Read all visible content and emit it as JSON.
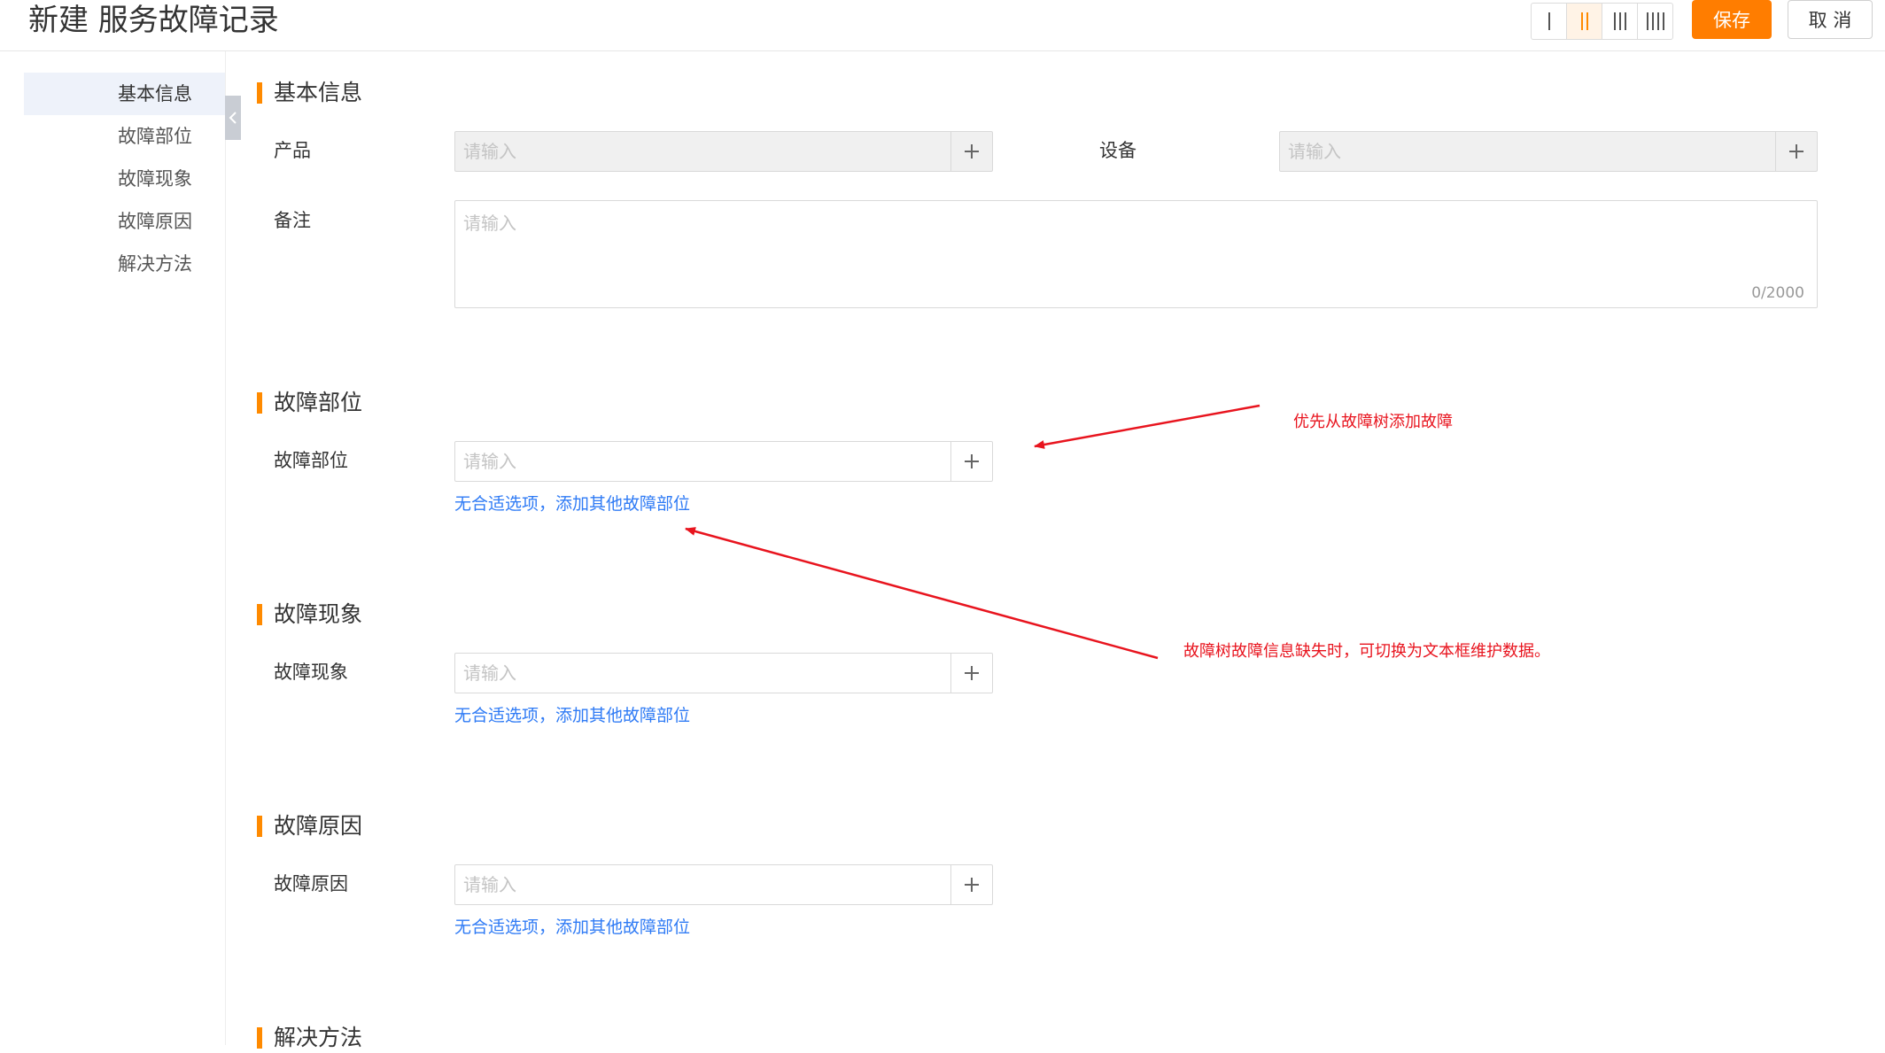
{
  "header": {
    "title": "新建 服务故障记录",
    "save_label": "保存",
    "cancel_label": "取 消",
    "layout_options": [
      "1",
      "2",
      "3",
      "4"
    ],
    "layout_selected": 2
  },
  "sidebar": {
    "items": [
      {
        "label": "基本信息",
        "active": true
      },
      {
        "label": "故障部位",
        "active": false
      },
      {
        "label": "故障现象",
        "active": false
      },
      {
        "label": "故障原因",
        "active": false
      },
      {
        "label": "解决方法",
        "active": false
      }
    ]
  },
  "sections": {
    "basic": {
      "title": "基本信息",
      "product_label": "产品",
      "product_placeholder": "请输入",
      "device_label": "设备",
      "device_placeholder": "请输入",
      "remark_label": "备注",
      "remark_placeholder": "请输入",
      "remark_counter": "0/2000"
    },
    "part": {
      "title": "故障部位",
      "field_label": "故障部位",
      "placeholder": "请输入",
      "link": "无合适选项，添加其他故障部位"
    },
    "phenomenon": {
      "title": "故障现象",
      "field_label": "故障现象",
      "placeholder": "请输入",
      "link": "无合适选项，添加其他故障部位"
    },
    "cause": {
      "title": "故障原因",
      "field_label": "故障原因",
      "placeholder": "请输入",
      "link": "无合适选项，添加其他故障部位"
    },
    "solution": {
      "title": "解决方法"
    }
  },
  "annotations": {
    "note1": "优先从故障树添加故障",
    "note2": "故障树故障信息缺失时，可切换为文本框维护数据。",
    "color": "#e8141e"
  },
  "colors": {
    "accent": "#ff7d00",
    "link": "#2f7bf5"
  }
}
